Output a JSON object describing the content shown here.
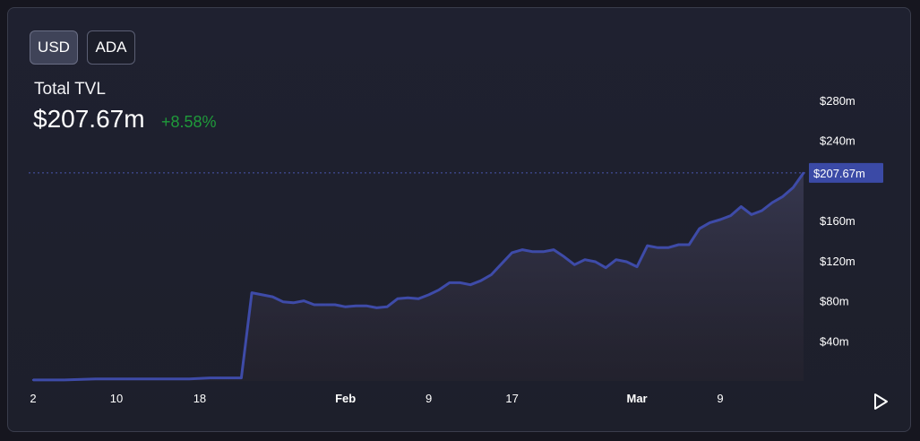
{
  "toggles": {
    "usd_label": "USD",
    "ada_label": "ADA",
    "selected": "USD"
  },
  "metric": {
    "label": "Total TVL",
    "value": "$207.67m",
    "change": "+8.58%"
  },
  "colors": {
    "line": "#3e4ba8",
    "change_positive": "#1f9a3a",
    "badge": "#3b4aa6"
  },
  "chart_data": {
    "type": "area",
    "title": "",
    "xlabel": "",
    "ylabel": "",
    "ylim": [
      0,
      300
    ],
    "y_unit": "$m",
    "grid": false,
    "x_tick_labels": [
      "2",
      "10",
      "18",
      "Feb",
      "9",
      "17",
      "Mar",
      "9"
    ],
    "y_tick_labels": [
      "$40m",
      "$80m",
      "$120m",
      "$160m",
      "$240m",
      "$280m"
    ],
    "y_ticks": [
      40,
      80,
      120,
      160,
      240,
      280
    ],
    "current_value_label": "$207.67m",
    "current_value": 207.67,
    "series": [
      {
        "x": [
          "Jan 2",
          "Jan 5",
          "Jan 8",
          "Jan 11",
          "Jan 14",
          "Jan 17",
          "Jan 19",
          "Jan 20",
          "Jan 22",
          "Jan 23",
          "Jan 24",
          "Jan 25",
          "Jan 26",
          "Jan 27",
          "Jan 28",
          "Jan 29",
          "Jan 30",
          "Jan 31",
          "Feb 1",
          "Feb 2",
          "Feb 3",
          "Feb 4",
          "Feb 5",
          "Feb 6",
          "Feb 7",
          "Feb 8",
          "Feb 9",
          "Feb 10",
          "Feb 11",
          "Feb 12",
          "Feb 13",
          "Feb 14",
          "Feb 15",
          "Feb 16",
          "Feb 17",
          "Feb 18",
          "Feb 19",
          "Feb 20",
          "Feb 21",
          "Feb 22",
          "Feb 23",
          "Feb 24",
          "Feb 25",
          "Feb 26",
          "Feb 27",
          "Feb 28",
          "Mar 1",
          "Mar 2",
          "Mar 3",
          "Mar 4",
          "Mar 5",
          "Mar 6",
          "Mar 7",
          "Mar 8",
          "Mar 9",
          "Mar 10",
          "Mar 11",
          "Mar 12",
          "Mar 13",
          "Mar 14",
          "Mar 15",
          "Mar 16",
          "Mar 17"
        ],
        "values": [
          1,
          1,
          2,
          2,
          2,
          2,
          3,
          3,
          3,
          88,
          86,
          84,
          79,
          78,
          80,
          76,
          76,
          76,
          74,
          75,
          75,
          73,
          74,
          82,
          83,
          82,
          86,
          91,
          98,
          98,
          96,
          100,
          106,
          117,
          128,
          131,
          129,
          129,
          131,
          124,
          116,
          121,
          119,
          113,
          121,
          119,
          114,
          135,
          133,
          133,
          136,
          136,
          152,
          158,
          161,
          165,
          174,
          166,
          170,
          178,
          184,
          193,
          207.67
        ]
      }
    ]
  }
}
